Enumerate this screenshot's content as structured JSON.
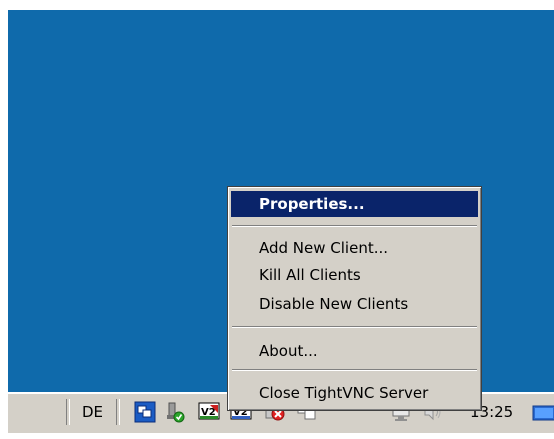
{
  "taskbar": {
    "language": "DE",
    "clock": "13:25",
    "tray_icons": [
      "network-icon",
      "vnc-remote-icon",
      "tightvnc-icon",
      "tightvnc-idle-icon",
      "network-error-icon",
      "network-icon-2",
      "display-icon",
      "volume-icon",
      "show-desktop-icon"
    ]
  },
  "context_menu": {
    "items": [
      {
        "label": "Properties...",
        "bold": true,
        "selected": true
      },
      {
        "label": "Add New Client..."
      },
      {
        "label": "Kill All Clients"
      },
      {
        "label": "Disable New Clients"
      },
      {
        "label": "About..."
      },
      {
        "label": "Close TightVNC Server"
      }
    ]
  },
  "colors": {
    "desktop": "#0f6aab",
    "taskbar": "#d4d0c8",
    "selection": "#0a246a"
  }
}
